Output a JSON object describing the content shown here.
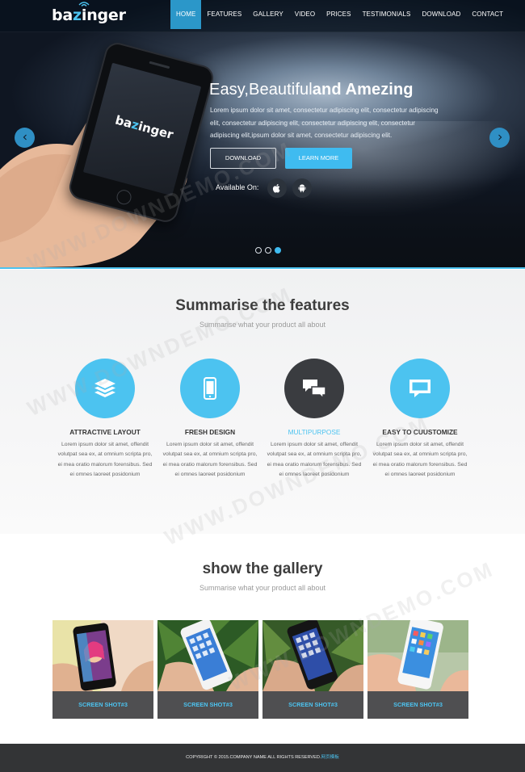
{
  "brand": {
    "logo_prefix": "ba",
    "logo_z": "z",
    "logo_suffix": "inger"
  },
  "nav": [
    "HOME",
    "FEATURES",
    "GALLERY",
    "VIDEO",
    "PRICES",
    "TESTIMONIALS",
    "DOWNLOAD",
    "CONTACT"
  ],
  "nav_active": "HOME",
  "hero": {
    "headline_light": "Easy,Beautiful",
    "headline_bold": "and Amezing",
    "copy": "Lorem ipsum dolor sit amet, consectetur adipiscing elit, consectetur adipiscing elit, consectetur adipiscing elit, consectetur adipiscing elit, consectetur adipiscing elit,ipsum dolor sit amet, consectetur adipiscing elit.",
    "btn_download": "DOWNLOAD",
    "btn_learn": "LEARN MORE",
    "available": "Available On:",
    "phone_logo_prefix": "ba",
    "phone_logo_z": "z",
    "phone_logo_suffix": "inger",
    "slide_count": 3,
    "active_slide": 3
  },
  "features": {
    "title": "Summarise the features",
    "subtitle": "Summarise what your product all about",
    "items": [
      {
        "title": "ATTRACTIVE LAYOUT",
        "icon": "layers-icon",
        "desc": "Lorem ipsum dolor sit amet, offendit volutpat sea ex, at omnium scripta pro, ei mea oratio malorum forensibus. Sed ei omnes laoreet posidonium"
      },
      {
        "title": "FRESH DESIGN",
        "icon": "mobile-icon",
        "desc": "Lorem ipsum dolor sit amet, offendit volutpat sea ex, at omnium scripta pro, ei mea oratio malorum forensibus. Sed ei omnes laoreet posidonium"
      },
      {
        "title": "MULTIPURPOSE",
        "icon": "chat-icon",
        "desc": "Lorem ipsum dolor sit amet, offendit volutpat sea ex, at omnium scripta pro, ei mea oratio malorum forensibus. Sed ei omnes laoreet posidonium"
      },
      {
        "title": "EASY TO CUUSTOMIZE",
        "icon": "message-icon",
        "desc": "Lorem ipsum dolor sit amet, offendit volutpat sea ex, at omnium scripta pro, ei mea oratio malorum forensibus. Sed ei omnes laoreet posidonium"
      }
    ]
  },
  "gallery": {
    "title": "show the gallery",
    "subtitle": "Summarise what your product all about",
    "shots": [
      "SCREEN SHOT#3",
      "SCREEN SHOT#3",
      "SCREEN SHOT#3",
      "SCREEN SHOT#3"
    ]
  },
  "footer": {
    "text": "COPYRIGHT © 2015.COMPANY NAME ALL RIGHTS RESERVED.",
    "link": "网页模板"
  },
  "watermark": "WWW.DOWNDEMO.COM",
  "colors": {
    "accent": "#4cc3f0",
    "dark": "#333436",
    "nav_active": "#2b97c9"
  }
}
